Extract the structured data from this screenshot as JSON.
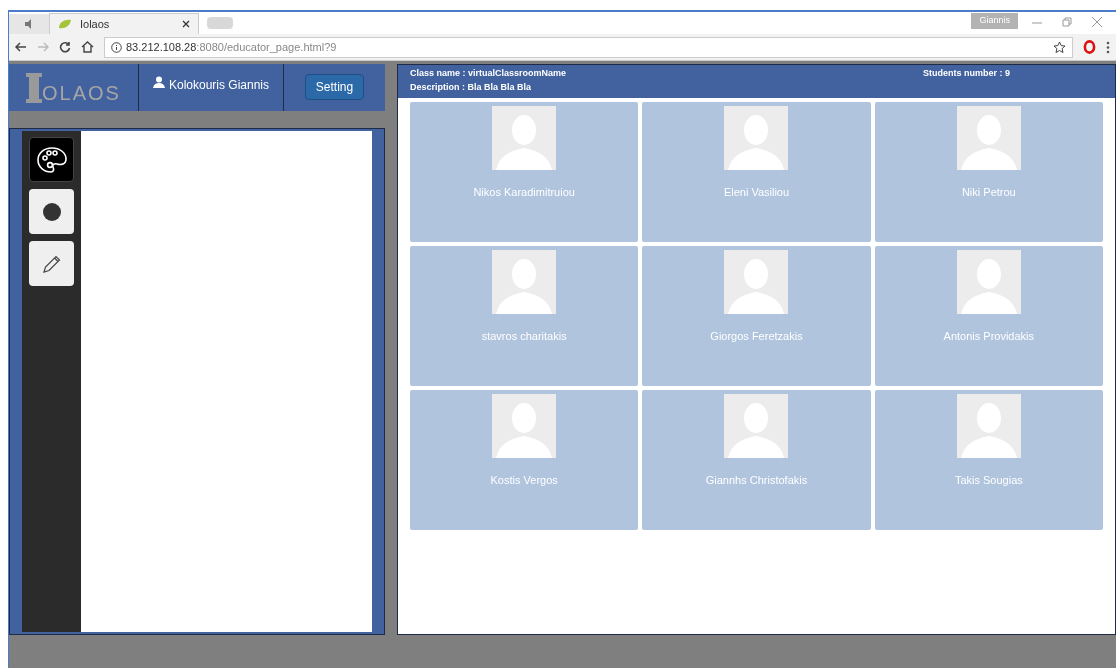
{
  "browser": {
    "tab_title": "Iolaos",
    "profile": "Giannis",
    "url_host": "83.212.108.28",
    "url_rest": ":8080/educator_page.html?9"
  },
  "header": {
    "logo": "OLAOS",
    "user": "Kolokouris Giannis",
    "setting_button": "Setting"
  },
  "tools": [
    {
      "kind": "palette",
      "selected": true
    },
    {
      "kind": "circle",
      "selected": false
    },
    {
      "kind": "pencil",
      "selected": false
    }
  ],
  "classroom": {
    "class_name": "Class name : virtualClassroomName",
    "description": "Description : Bla Bla Bla Bla",
    "students_number": "Students number : 9"
  },
  "students": [
    {
      "name": "Nikos Karadimitruiou"
    },
    {
      "name": "Eleni Vasiliou"
    },
    {
      "name": "Niki Petrou"
    },
    {
      "name": "stavros charitakis"
    },
    {
      "name": "Giorgos Feretzakis"
    },
    {
      "name": "Antonis Providakis"
    },
    {
      "name": "Kostis Vergos"
    },
    {
      "name": "Giannhs Christofakis"
    },
    {
      "name": "Takis Sougias"
    }
  ]
}
